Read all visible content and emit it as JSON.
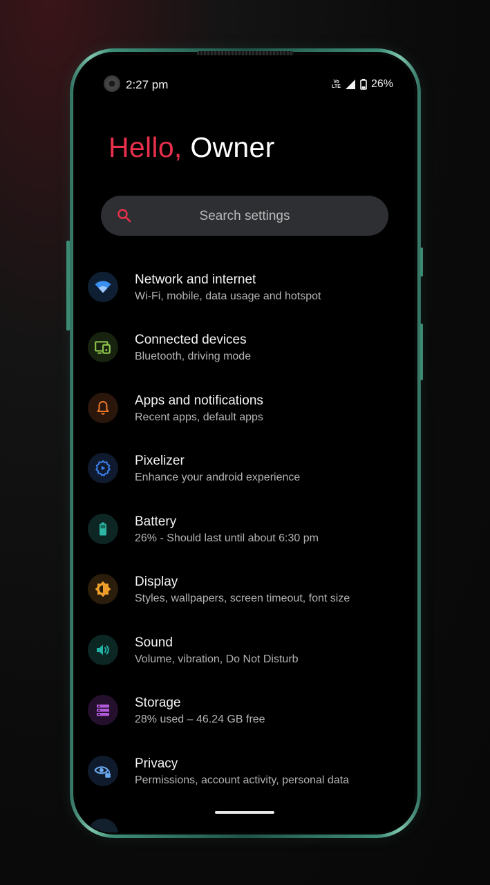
{
  "status_bar": {
    "time": "2:27 pm",
    "network_badge_top": "VoLTE",
    "network_badge_bottom": "LTE",
    "battery_percent": "26%"
  },
  "greeting": {
    "hello": "Hello,",
    "name": "Owner"
  },
  "search": {
    "placeholder": "Search settings",
    "icon": "search-icon",
    "accent": "#e8304c"
  },
  "settings": [
    {
      "title": "Network and internet",
      "subtitle": "Wi-Fi, mobile, data usage and hotspot",
      "icon": "wifi-icon",
      "color": "#3b8ff0",
      "bg": "#0f1f33"
    },
    {
      "title": "Connected devices",
      "subtitle": "Bluetooth, driving mode",
      "icon": "devices-icon",
      "color": "#8bc34a",
      "bg": "#17220f"
    },
    {
      "title": "Apps and notifications",
      "subtitle": "Recent apps, default apps",
      "icon": "bell-icon",
      "color": "#f07a2a",
      "bg": "#2b160b"
    },
    {
      "title": "Pixelizer",
      "subtitle": "Enhance your android experience",
      "icon": "gear-icon",
      "color": "#3b82f0",
      "bg": "#0f1a2e"
    },
    {
      "title": "Battery",
      "subtitle": "26% - Should last until about 6:30 pm",
      "icon": "battery-icon",
      "color": "#2bb7a3",
      "bg": "#0d2623"
    },
    {
      "title": "Display",
      "subtitle": "Styles, wallpapers, screen timeout, font size",
      "icon": "brightness-icon",
      "color": "#f0a02a",
      "bg": "#2b1d0b"
    },
    {
      "title": "Sound",
      "subtitle": "Volume, vibration, Do Not Disturb",
      "icon": "volume-icon",
      "color": "#23b3a6",
      "bg": "#0c2624"
    },
    {
      "title": "Storage",
      "subtitle": "28% used – 46.24 GB free",
      "icon": "storage-icon",
      "color": "#b05ad8",
      "bg": "#24102d"
    },
    {
      "title": "Privacy",
      "subtitle": "Permissions, account activity, personal data",
      "icon": "privacy-eye-icon",
      "color": "#6aa8f0",
      "bg": "#0f1b2c"
    }
  ]
}
